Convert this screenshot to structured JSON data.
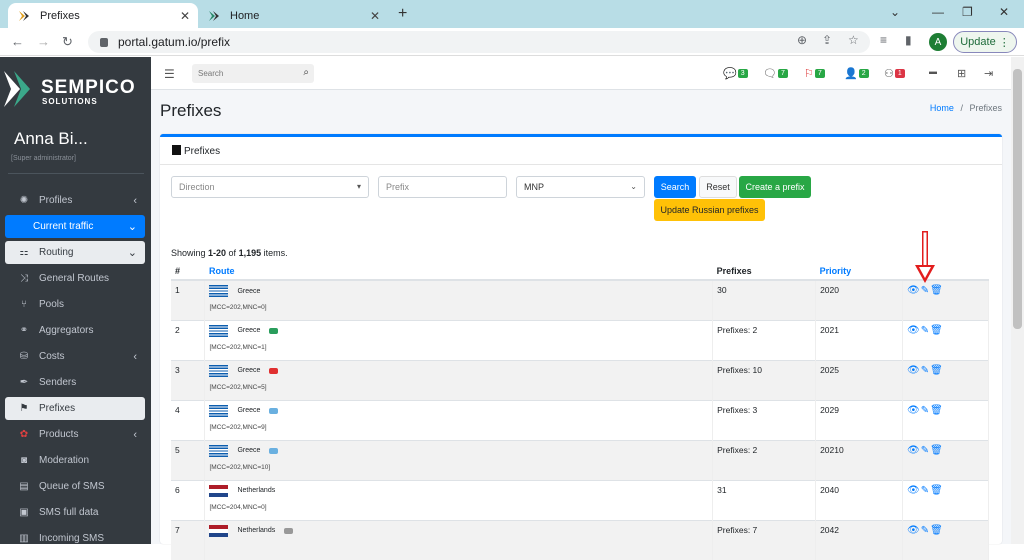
{
  "browser": {
    "tabs": [
      {
        "title": "Prefixes",
        "active": true
      },
      {
        "title": "Home",
        "active": false
      }
    ],
    "url": "portal.gatum.io/prefix",
    "profile_initial": "A",
    "update_label": "Update"
  },
  "sidebar": {
    "brand": "SEMPICO",
    "brand_sub": "SOLUTIONS",
    "user_name": "Anna Bi...",
    "user_role": "[Super administrator]",
    "items": [
      {
        "label": "Profiles",
        "icon": "profiles-icon"
      },
      {
        "label": "Current traffic",
        "icon": ""
      },
      {
        "label": "Routing",
        "icon": "routing-icon"
      },
      {
        "label": "General Routes",
        "icon": "routes-icon"
      },
      {
        "label": "Pools",
        "icon": "pools-icon"
      },
      {
        "label": "Aggregators",
        "icon": "aggregators-icon"
      },
      {
        "label": "Costs",
        "icon": "costs-icon"
      },
      {
        "label": "Senders",
        "icon": "senders-icon"
      },
      {
        "label": "Prefixes",
        "icon": "flag-icon"
      },
      {
        "label": "Products",
        "icon": "products-icon"
      },
      {
        "label": "Moderation",
        "icon": "moderation-icon"
      },
      {
        "label": "Queue of SMS",
        "icon": "queue-icon"
      },
      {
        "label": "SMS full data",
        "icon": "sms-data-icon"
      },
      {
        "label": "Incoming SMS",
        "icon": "incoming-icon"
      }
    ]
  },
  "topnav": {
    "search_placeholder": "Search",
    "badges": [
      "3",
      "7",
      "7",
      "2",
      "1"
    ]
  },
  "page": {
    "title": "Prefixes",
    "breadcrumb_home": "Home",
    "breadcrumb_sep": "/",
    "breadcrumb_current": "Prefixes",
    "card_title": "Prefixes"
  },
  "filters": {
    "direction_placeholder": "Direction",
    "prefix_placeholder": "Prefix",
    "mnp_value": "MNP",
    "search_label": "Search",
    "reset_label": "Reset",
    "create_label": "Create a prefix",
    "update_russian_label": "Update Russian prefixes"
  },
  "table": {
    "summary_prefix": "Showing ",
    "summary_range": "1-20",
    "summary_mid": " of ",
    "summary_total": "1,195",
    "summary_suffix": " items.",
    "headers": {
      "num": "#",
      "route": "Route",
      "prefixes": "Prefixes",
      "priority": "Priority"
    },
    "rows": [
      {
        "num": "1",
        "country": "Greece",
        "flag": "gr",
        "mcc": "[MCC=202,MNC=0]",
        "prefixes": "30",
        "priority": "2020",
        "op_logo": ""
      },
      {
        "num": "2",
        "country": "Greece",
        "flag": "gr",
        "mcc": "[MCC=202,MNC=1]",
        "prefixes": "Prefixes: 2",
        "priority": "2021",
        "op_logo": "#2a9d5c"
      },
      {
        "num": "3",
        "country": "Greece",
        "flag": "gr",
        "mcc": "[MCC=202,MNC=5]",
        "prefixes": "Prefixes: 10",
        "priority": "2025",
        "op_logo": "#e03030"
      },
      {
        "num": "4",
        "country": "Greece",
        "flag": "gr",
        "mcc": "[MCC=202,MNC=9]",
        "prefixes": "Prefixes: 3",
        "priority": "2029",
        "op_logo": "#6ab0e0"
      },
      {
        "num": "5",
        "country": "Greece",
        "flag": "gr",
        "mcc": "[MCC=202,MNC=10]",
        "prefixes": "Prefixes: 2",
        "priority": "20210",
        "op_logo": "#6ab0e0"
      },
      {
        "num": "6",
        "country": "Netherlands",
        "flag": "nl",
        "mcc": "[MCC=204,MNC=0]",
        "prefixes": "31",
        "priority": "2040",
        "op_logo": ""
      },
      {
        "num": "7",
        "country": "Netherlands",
        "flag": "nl",
        "mcc": "",
        "prefixes": "Prefixes: 7",
        "priority": "2042",
        "op_logo": "#999999"
      }
    ]
  },
  "colors": {
    "primary": "#007bff",
    "success": "#28a745",
    "warning": "#ffc107",
    "sidebar": "#343a40",
    "annotation_arrow": "#e21d1d"
  }
}
